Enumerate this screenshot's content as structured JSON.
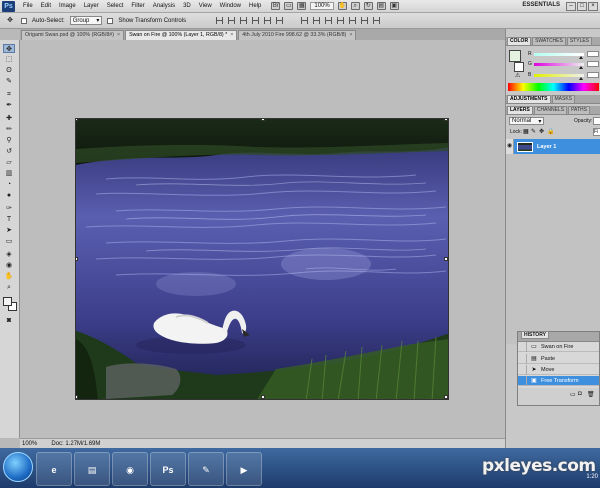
{
  "app": {
    "logo_text": "Ps",
    "menu": [
      "File",
      "Edit",
      "Image",
      "Layer",
      "Select",
      "Filter",
      "Analysis",
      "3D",
      "View",
      "Window",
      "Help"
    ],
    "zoom_level": "100%",
    "workspace": "ESSENTIALS",
    "window_controls": [
      "–",
      "□",
      "×"
    ]
  },
  "options_bar": {
    "auto_select_label": "Auto-Select:",
    "auto_select_value": "Group",
    "show_transform_label": "Show Transform Controls"
  },
  "doc_tabs": [
    {
      "label": "Origami Swan.psd @ 100% (RGB/8#)",
      "active": false
    },
    {
      "label": "Swan on Fire @ 100% (Layer 1, RGB/8) *",
      "active": true
    },
    {
      "label": "4th July 2010 Fire 998.62 @ 33.3% (RGB/8)",
      "active": false
    }
  ],
  "status_bar": {
    "zoom": "100%",
    "doc_info": "Doc: 1.27M/1.69M"
  },
  "color_panel": {
    "tabs": [
      "COLOR",
      "SWATCHES",
      "STYLES"
    ],
    "channels": [
      {
        "label": "R",
        "value": "",
        "pos": 0.93
      },
      {
        "label": "G",
        "value": "",
        "pos": 0.93
      },
      {
        "label": "B",
        "value": "",
        "pos": 0.93
      }
    ]
  },
  "adjust_panel": {
    "tabs": [
      "ADJUSTMENTS",
      "MASKS"
    ]
  },
  "layers_panel": {
    "tabs": [
      "LAYERS",
      "CHANNELS",
      "PATHS"
    ],
    "blend_mode": "Normal",
    "opacity_label": "Opacity:",
    "opacity_value": "",
    "lock_label": "Lock:",
    "fill_value": "Fi",
    "layers": [
      {
        "name": "Layer 1",
        "selected": true
      }
    ]
  },
  "history_panel": {
    "title": "HISTORY",
    "items": [
      {
        "label": "Swan on Fire",
        "icon": "document-icon",
        "selected": false
      },
      {
        "label": "Paste",
        "icon": "paste-icon",
        "selected": false
      },
      {
        "label": "Move",
        "icon": "move-icon",
        "selected": false
      },
      {
        "label": "Free Transform",
        "icon": "transform-icon",
        "selected": true
      }
    ]
  },
  "watermark": {
    "text": "pxleyes.com"
  },
  "clock": "1:20"
}
